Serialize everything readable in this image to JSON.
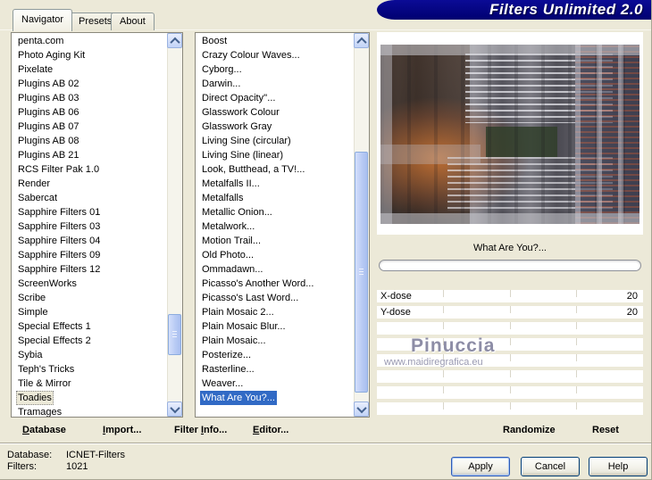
{
  "window": {
    "title": "Filters Unlimited 2.0"
  },
  "colors": {
    "dialog_bg": "#ECE9D8",
    "banner_bg": "#010080",
    "selection": "#316AC5",
    "list_bg": "#FFFFFF"
  },
  "tabs": [
    {
      "label": "Navigator",
      "active": true
    },
    {
      "label": "Presets",
      "active": false
    },
    {
      "label": "About",
      "active": false
    }
  ],
  "category_list": {
    "items": [
      "penta.com",
      "Photo Aging Kit",
      "Pixelate",
      "Plugins AB 02",
      "Plugins AB 03",
      "Plugins AB 06",
      "Plugins AB 07",
      "Plugins AB 08",
      "Plugins AB 21",
      "RCS Filter Pak 1.0",
      "Render",
      "Sabercat",
      "Sapphire Filters 01",
      "Sapphire Filters 03",
      "Sapphire Filters 04",
      "Sapphire Filters 09",
      "Sapphire Filters 12",
      "ScreenWorks",
      "Scribe",
      "Simple",
      "Special Effects 1",
      "Special Effects 2",
      "Sybia",
      "Teph's Tricks",
      "Tile & Mirror",
      "Toadies",
      "Tramages"
    ],
    "selected": "Toadies"
  },
  "filter_list": {
    "items": [
      "Boost",
      "Crazy Colour Waves...",
      "Cyborg...",
      "Darwin...",
      "Direct Opacity''...",
      "Glasswork Colour",
      "Glasswork Gray",
      "Living Sine (circular)",
      "Living Sine (linear)",
      "Look, Butthead, a TV!...",
      "Metalfalls II...",
      "Metalfalls",
      "Metallic Onion...",
      "Metalwork...",
      "Motion Trail...",
      "Old Photo...",
      "Ommadawn...",
      "Picasso's Another Word...",
      "Picasso's Last Word...",
      "Plain Mosaic 2...",
      "Plain Mosaic Blur...",
      "Plain Mosaic...",
      "Posterize...",
      "Rasterline...",
      "Weaver...",
      "What Are You?..."
    ],
    "selected": "What Are You?..."
  },
  "preview": {
    "caption": "What Are You?..."
  },
  "controls": {
    "rows": [
      {
        "label": "X-dose",
        "value": "20"
      },
      {
        "label": "Y-dose",
        "value": "20"
      }
    ],
    "empty_rows": 6
  },
  "watermark": {
    "name": "Pinuccia",
    "url": "www.maidiregrafica.eu"
  },
  "command_buttons": [
    {
      "label": "Database",
      "underline_index": 0
    },
    {
      "label": "Import...",
      "underline_index": 0
    },
    {
      "label": "Filter Info...",
      "underline_index": 7
    },
    {
      "label": "Editor...",
      "underline_index": 0
    },
    {
      "label": "Randomize",
      "underline_index": -1
    },
    {
      "label": "Reset",
      "underline_index": -1
    }
  ],
  "status": {
    "rows": [
      {
        "label": "Database:",
        "value": "ICNET-Filters"
      },
      {
        "label": "Filters:",
        "value": "1021"
      }
    ]
  },
  "action_buttons": [
    {
      "label": "Apply",
      "default": true
    },
    {
      "label": "Cancel",
      "default": false
    },
    {
      "label": "Help",
      "default": false
    }
  ]
}
